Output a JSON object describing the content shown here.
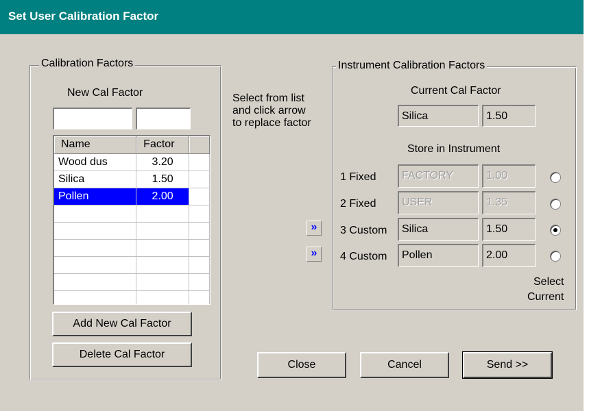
{
  "window": {
    "title": "Set User Calibration Factor"
  },
  "left_group": {
    "legend": "Calibration Factors",
    "new_cal_label": "New Cal Factor",
    "name_input": "",
    "factor_input": "",
    "table": {
      "headers": [
        "Name",
        "Factor"
      ],
      "rows": [
        {
          "name": "Wood dus",
          "factor": "3.20",
          "selected": false
        },
        {
          "name": "Silica",
          "factor": "1.50",
          "selected": false
        },
        {
          "name": "Pollen",
          "factor": "2.00",
          "selected": true
        }
      ]
    },
    "add_button": "Add New Cal Factor",
    "delete_button": "Delete Cal Factor"
  },
  "instructions": [
    "Select from list",
    "and click arrow",
    "to replace factor"
  ],
  "right_group": {
    "legend": "Instrument Calibration Factors",
    "current_label": "Current Cal Factor",
    "current_name": "Silica",
    "current_factor": "1.50",
    "store_label": "Store in Instrument",
    "slots": [
      {
        "label": "1 Fixed",
        "name": "FACTORY",
        "factor": "1.00",
        "disabled": true,
        "selected": false
      },
      {
        "label": "2 Fixed",
        "name": "USER",
        "factor": "1.35",
        "disabled": true,
        "selected": false
      },
      {
        "label": "3 Custom",
        "name": "Silica",
        "factor": "1.50",
        "disabled": false,
        "selected": true
      },
      {
        "label": "4 Custom",
        "name": "Pollen",
        "factor": "2.00",
        "disabled": false,
        "selected": false
      }
    ],
    "select_current": [
      "Select",
      "Current"
    ]
  },
  "arrow_glyph": "»",
  "buttons": {
    "close": "Close",
    "cancel": "Cancel",
    "send": "Send >>"
  }
}
